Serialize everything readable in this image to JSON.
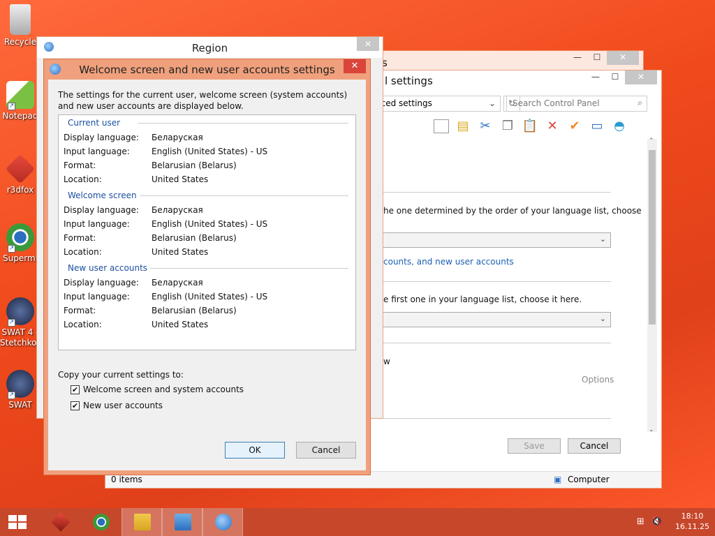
{
  "desktop": {
    "icons": [
      {
        "label": "Recycle",
        "icon": "recycle-bin-icon"
      },
      {
        "label": "Notepad",
        "icon": "notepad-icon"
      },
      {
        "label": "r3dfox",
        "icon": "r3dfox-icon"
      },
      {
        "label": "Supermi",
        "icon": "browser-icon"
      },
      {
        "label": "SWAT 4 -",
        "label2": "Stetchkov",
        "icon": "swat-icon"
      },
      {
        "label": "SWAT",
        "icon": "swat-icon"
      }
    ]
  },
  "control_panel": {
    "title_partial": "l settings",
    "title_back": "s",
    "address": "nced settings",
    "search_placeholder": "Search Control Panel",
    "text1": "he one determined by the order of your language list, choose",
    "link1": "counts, and new user accounts",
    "text2": "e first one in your language list, choose it here.",
    "text3": "w",
    "options": "Options",
    "save": "Save",
    "cancel": "Cancel",
    "status_left": "0 items",
    "status_right": "Computer"
  },
  "region": {
    "title": "Region"
  },
  "dialog": {
    "title": "Welcome screen and new user accounts settings",
    "intro": "The settings for the current user, welcome screen (system accounts) and new user accounts are displayed below.",
    "groups": [
      {
        "title": "Current user",
        "rows": [
          {
            "key": "Display language:",
            "value": "Беларуская"
          },
          {
            "key": "Input language:",
            "value": "English (United States) - US"
          },
          {
            "key": "Format:",
            "value": "Belarusian (Belarus)"
          },
          {
            "key": "Location:",
            "value": "United States"
          }
        ]
      },
      {
        "title": "Welcome screen",
        "rows": [
          {
            "key": "Display language:",
            "value": "Беларуская"
          },
          {
            "key": "Input language:",
            "value": "English (United States) - US"
          },
          {
            "key": "Format:",
            "value": "Belarusian (Belarus)"
          },
          {
            "key": "Location:",
            "value": "United States"
          }
        ]
      },
      {
        "title": "New user accounts",
        "rows": [
          {
            "key": "Display language:",
            "value": "Беларуская"
          },
          {
            "key": "Input language:",
            "value": "English (United States) - US"
          },
          {
            "key": "Format:",
            "value": "Belarusian (Belarus)"
          },
          {
            "key": "Location:",
            "value": "United States"
          }
        ]
      }
    ],
    "copy_title": "Copy your current settings to:",
    "checkboxes": [
      {
        "label": "Welcome screen and system accounts",
        "checked": true
      },
      {
        "label": "New user accounts",
        "checked": true
      }
    ],
    "ok": "OK",
    "cancel": "Cancel",
    "close_glyph": "✕"
  },
  "taskbar": {
    "items": [
      "start-icon",
      "r3dfox-icon",
      "browser-icon",
      "file-explorer-icon",
      "control-panel-icon",
      "region-icon"
    ],
    "time": "18:10",
    "date": "16.11.25"
  },
  "colors": {
    "accent": "#f0a07c",
    "close_red": "#d9453b",
    "taskbar": "#c7472a",
    "link_blue": "#1a4fa0"
  }
}
